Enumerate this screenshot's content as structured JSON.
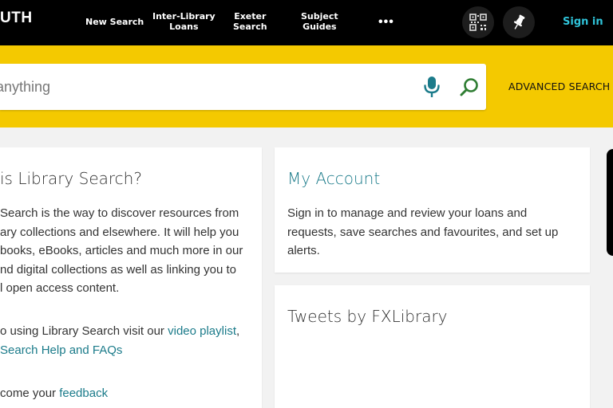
{
  "header": {
    "logo_text": "UTH",
    "nav": [
      {
        "label_line1": "New Search",
        "label_line2": ""
      },
      {
        "label_line1": "Inter-Library",
        "label_line2": "Loans"
      },
      {
        "label_line1": "Exeter",
        "label_line2": "Search"
      },
      {
        "label_line1": "Subject",
        "label_line2": "Guides"
      }
    ],
    "more_label": "•••",
    "qr_icon": "qr-code-icon",
    "pin_icon": "pin-icon",
    "signin_label": "Sign in"
  },
  "search": {
    "placeholder": "n anything",
    "mic_icon": "microphone-icon",
    "go_icon": "search-icon",
    "advanced_label": "ADVANCED SEARCH"
  },
  "about": {
    "title": "is Library Search?",
    "paragraph_lines": [
      "Search is the way to discover resources from",
      "ary collections and elsewhere. It will help you",
      "books, eBooks, articles and much more in our",
      "nd digital collections as well as linking you to",
      "l open access content."
    ],
    "help_line1_prefix": "o using Library Search visit our ",
    "help_link1": "video playlist",
    "help_line1_suffix": ",",
    "help_link2": "Search Help and FAQs",
    "feedback_prefix": "come your ",
    "feedback_link": "feedback"
  },
  "account": {
    "title": "My Account",
    "lines": [
      "Sign in to manage and review your loans and",
      "requests, save searches and favourites, and set up",
      "alerts."
    ]
  },
  "tweets": {
    "title": "Tweets by FXLibrary"
  },
  "colors": {
    "topbar": "#000000",
    "band": "#f4c900",
    "accent_teal": "#1b7b8a",
    "signin": "#2fc3d9",
    "search_icon_green": "#2e7d32"
  }
}
